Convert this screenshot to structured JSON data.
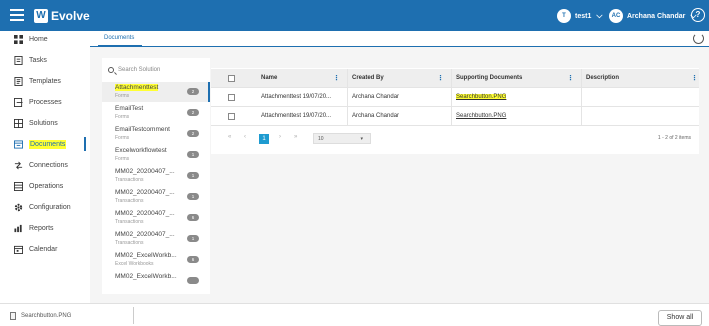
{
  "app": {
    "logo_mark": "W",
    "name": "Evolve"
  },
  "header": {
    "tenant": {
      "initial": "T",
      "name": "test1"
    },
    "user": {
      "initials": "AC",
      "name": "Archana Chandar"
    },
    "help_icon": "help-circle-icon"
  },
  "sidebar": {
    "items": [
      {
        "label": "Home",
        "icon": "home-icon"
      },
      {
        "label": "Tasks",
        "icon": "tasks-icon"
      },
      {
        "label": "Templates",
        "icon": "templates-icon"
      },
      {
        "label": "Processes",
        "icon": "processes-icon"
      },
      {
        "label": "Solutions",
        "icon": "solutions-icon"
      },
      {
        "label": "Documents",
        "icon": "documents-icon",
        "active": true
      },
      {
        "label": "Connections",
        "icon": "connections-icon"
      },
      {
        "label": "Operations",
        "icon": "operations-icon"
      },
      {
        "label": "Configuration",
        "icon": "gear-icon"
      },
      {
        "label": "Reports",
        "icon": "reports-icon"
      },
      {
        "label": "Calendar",
        "icon": "calendar-icon"
      }
    ]
  },
  "tabs": {
    "documents": "Documents"
  },
  "search": {
    "placeholder": "Search Solution"
  },
  "solutions": [
    {
      "name": "Attachmenttest",
      "type": "Forms",
      "count": "2"
    },
    {
      "name": "EmailTest",
      "type": "Forms",
      "count": "2"
    },
    {
      "name": "EmailTestcomment",
      "type": "Forms",
      "count": "2"
    },
    {
      "name": "Excelworkflowtest",
      "type": "Forms",
      "count": "1"
    },
    {
      "name": "MM02_20200407_...",
      "type": "Transactions",
      "count": "1"
    },
    {
      "name": "MM02_20200407_...",
      "type": "Transactions",
      "count": "1"
    },
    {
      "name": "MM02_20200407_...",
      "type": "Transactions",
      "count": "6"
    },
    {
      "name": "MM02_20200407_...",
      "type": "Transactions",
      "count": "1"
    },
    {
      "name": "MM02_ExcelWorkb...",
      "type": "Excel Workbooks",
      "count": "6"
    },
    {
      "name": "MM02_ExcelWorkb...",
      "type": "",
      "count": ""
    }
  ],
  "table": {
    "columns": [
      "Name",
      "Created By",
      "Supporting Documents",
      "Description"
    ],
    "rows": [
      {
        "name": "Attachmenttest 19/07/20...",
        "created_by": "Archana Chandar",
        "supporting": "Searchbutton.PNG",
        "description": ""
      },
      {
        "name": "Attachmenttest 19/07/20...",
        "created_by": "Archana Chandar",
        "supporting": "Searchbutton.PNG",
        "description": ""
      }
    ]
  },
  "pagination": {
    "first": "«",
    "prev": "‹",
    "current": "1",
    "next": "›",
    "last": "»",
    "page_size": "10",
    "range": "1 - 2 of 2 items"
  },
  "downloads": {
    "file": "Searchbutton.PNG",
    "show_all": "Show all"
  }
}
